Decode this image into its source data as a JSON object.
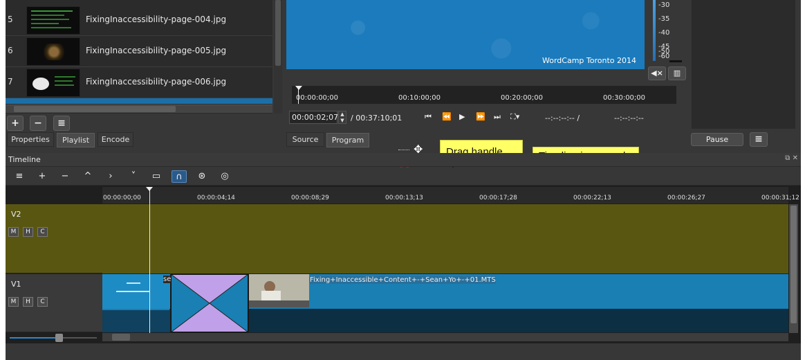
{
  "playlist": {
    "rows": [
      {
        "num": "5",
        "name": "FixingInaccessibility-page-004.jpg"
      },
      {
        "num": "6",
        "name": "FixingInaccessibility-page-005.jpg"
      },
      {
        "num": "7",
        "name": "FixingInaccessibility-page-006.jpg"
      }
    ],
    "tabs": {
      "properties": "Properties",
      "playlist": "Playlist",
      "encode": "Encode"
    },
    "buttons": {
      "add": "+",
      "remove": "−",
      "menu": "≡"
    }
  },
  "preview": {
    "caption": "WordCamp Toronto 2014",
    "ruler_labels": [
      "00:00:00;00",
      "00:10:00;00",
      "00:20:00;00",
      "00:30:00;00"
    ],
    "current_tc": "00:00:02;07",
    "total_tc": "/ 00:37:10;01",
    "in_point": "--:--:--:-- /",
    "out_point": "--:--:--:--",
    "tabs": {
      "source": "Source",
      "program": "Program"
    }
  },
  "meter": {
    "labels": [
      "-30",
      "-35",
      "-40",
      "-45",
      "-50",
      "-55",
      "-60"
    ]
  },
  "right": {
    "pause": "Pause",
    "menu": "≡"
  },
  "callouts": {
    "drag": "Drag handle up",
    "increased": "Timeline increased"
  },
  "timeline": {
    "title": "Timeline",
    "toolbar": [
      "≡",
      "+",
      "−",
      "^",
      "›",
      "˅",
      "▭",
      "∩",
      "⊛",
      "◎"
    ],
    "ruler_labels": [
      "00:00:00;00",
      "00:00:04;14",
      "00:00:08;29",
      "00:00:13;13",
      "00:00:17;28",
      "00:00:22;13",
      "00:00:26;27",
      "00:00:31;12"
    ],
    "tracks": [
      {
        "name": "V2",
        "m": "M",
        "h": "H",
        "c": "C"
      },
      {
        "name": "V1",
        "m": "M",
        "h": "H",
        "c": "C"
      }
    ],
    "clip_prefix": "se",
    "clip_name": "Fixing+Inaccessible+Content+-+Sean+Yo+-+01.MTS"
  },
  "colors": {
    "v2_track": "#595612",
    "clip_blue": "#1a7fb2",
    "callout": "#ffff66",
    "arrow": "#cc1111"
  }
}
